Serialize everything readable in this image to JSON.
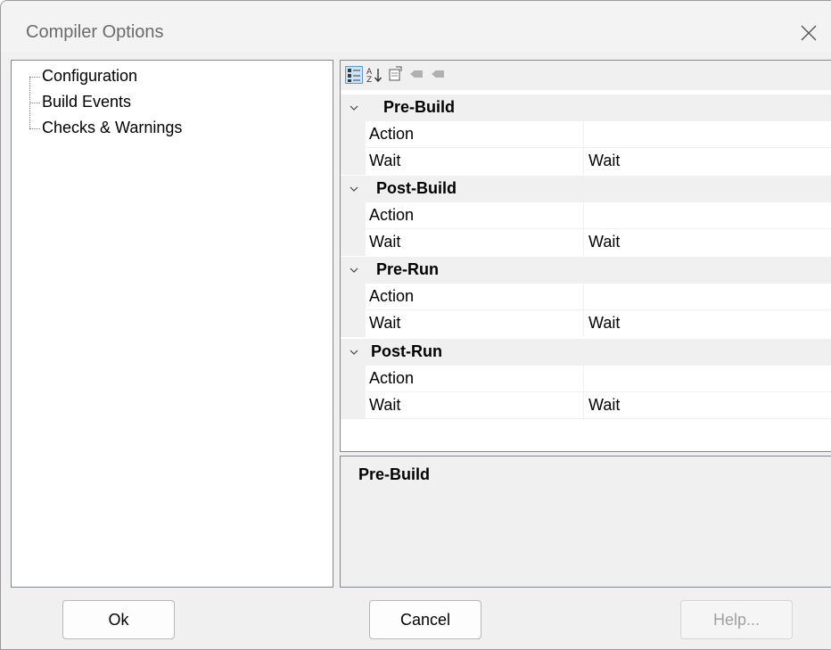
{
  "window": {
    "title": "Compiler Options"
  },
  "tree": {
    "items": [
      {
        "label": "Configuration"
      },
      {
        "label": "Build Events"
      },
      {
        "label": "Checks & Warnings"
      }
    ]
  },
  "toolbar": {
    "buttons": [
      {
        "icon": "categorized-icon",
        "active": true
      },
      {
        "icon": "sort-alphabetical-icon",
        "active": false
      },
      {
        "icon": "property-pages-icon",
        "active": false
      },
      {
        "icon": "back-icon",
        "active": false
      },
      {
        "icon": "forward-icon",
        "active": false
      }
    ]
  },
  "property_grid": {
    "categories": [
      {
        "label": "Pre-Build",
        "rows": [
          {
            "name": "Action",
            "value": ""
          },
          {
            "name": "Wait",
            "value": "Wait"
          }
        ]
      },
      {
        "label": "Post-Build",
        "rows": [
          {
            "name": "Action",
            "value": ""
          },
          {
            "name": "Wait",
            "value": "Wait"
          }
        ]
      },
      {
        "label": "Pre-Run",
        "rows": [
          {
            "name": "Action",
            "value": ""
          },
          {
            "name": "Wait",
            "value": "Wait"
          }
        ]
      },
      {
        "label": "Post-Run",
        "rows": [
          {
            "name": "Action",
            "value": ""
          },
          {
            "name": "Wait",
            "value": "Wait"
          }
        ]
      }
    ]
  },
  "description": {
    "title": "Pre-Build"
  },
  "buttons": {
    "ok": "Ok",
    "cancel": "Cancel",
    "help": "Help..."
  },
  "colors": {
    "accent": "#5a9ad6",
    "selection_bg": "#cce4f7",
    "panel_bg": "#f0f0f0"
  }
}
